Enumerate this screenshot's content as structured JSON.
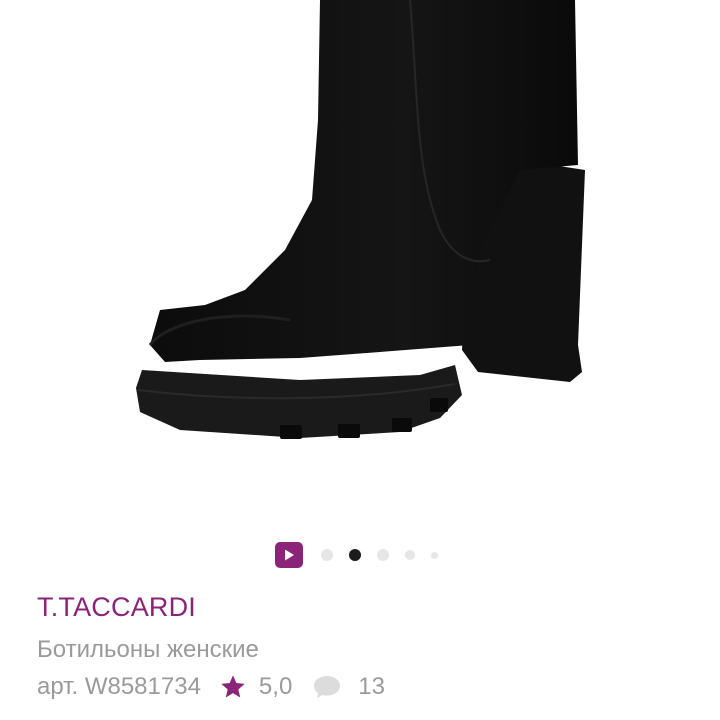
{
  "colors": {
    "accent": "#8b2479",
    "text_muted": "#9a9a9a",
    "active_dot": "#1c1c1c",
    "inactive_dot": "#e6e6e6"
  },
  "gallery": {
    "image_description": "black suede high-heel ankle boot",
    "video_icon": "play-icon",
    "slide_count": 6,
    "active_slide": 2
  },
  "product": {
    "brand": "T.TACCARDI",
    "name": "Ботильоны женские",
    "article": "арт. W8581734",
    "rating": "5,0",
    "rating_icon": "star-icon",
    "reviews_count": "13",
    "reviews_icon": "comment-icon"
  }
}
